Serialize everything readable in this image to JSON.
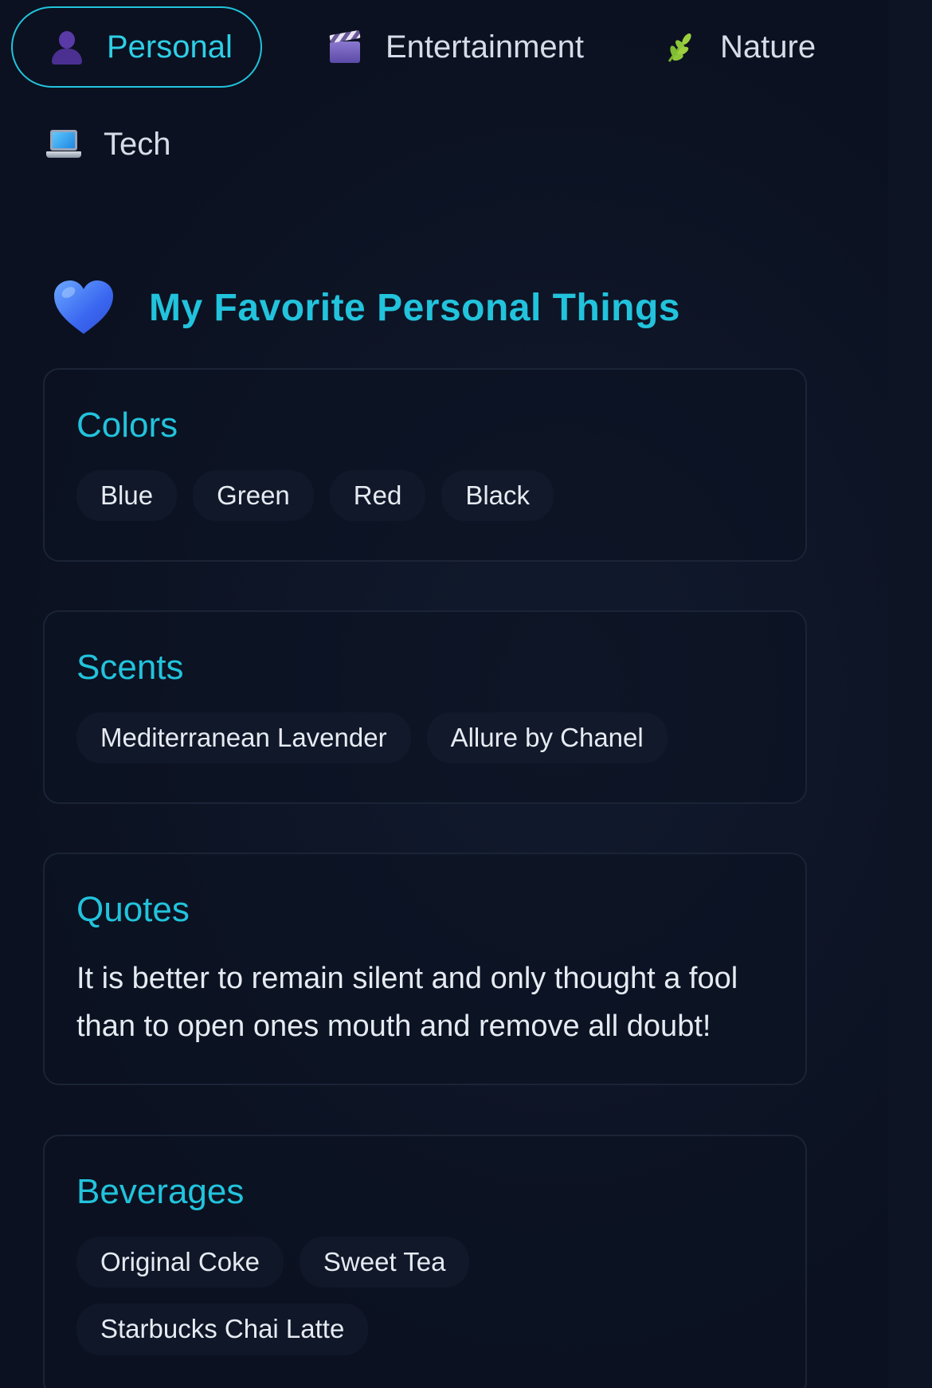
{
  "tabs": [
    {
      "label": "Personal",
      "icon": "person-icon",
      "active": true
    },
    {
      "label": "Entertainment",
      "icon": "clapper-board-icon",
      "active": false
    },
    {
      "label": "Nature",
      "icon": "leaf-icon",
      "active": false
    },
    {
      "label": "Tech",
      "icon": "laptop-icon",
      "active": false
    }
  ],
  "header": {
    "icon": "blue-heart-icon",
    "title": "My Favorite Personal Things"
  },
  "sections": {
    "colors": {
      "title": "Colors",
      "items": [
        "Blue",
        "Green",
        "Red",
        "Black"
      ]
    },
    "scents": {
      "title": "Scents",
      "items": [
        "Mediterranean Lavender",
        "Allure by Chanel"
      ]
    },
    "quotes": {
      "title": "Quotes",
      "text": "It is better to remain silent and only thought a fool than to open ones mouth and remove all doubt!"
    },
    "beverages": {
      "title": "Beverages",
      "items": [
        "Original Coke",
        "Sweet Tea",
        "Starbucks Chai Latte"
      ]
    }
  },
  "colors": {
    "background": "#0b1120",
    "accent": "#22c3dc",
    "text": "#e6ebf2",
    "card_border": "#1b2436"
  }
}
